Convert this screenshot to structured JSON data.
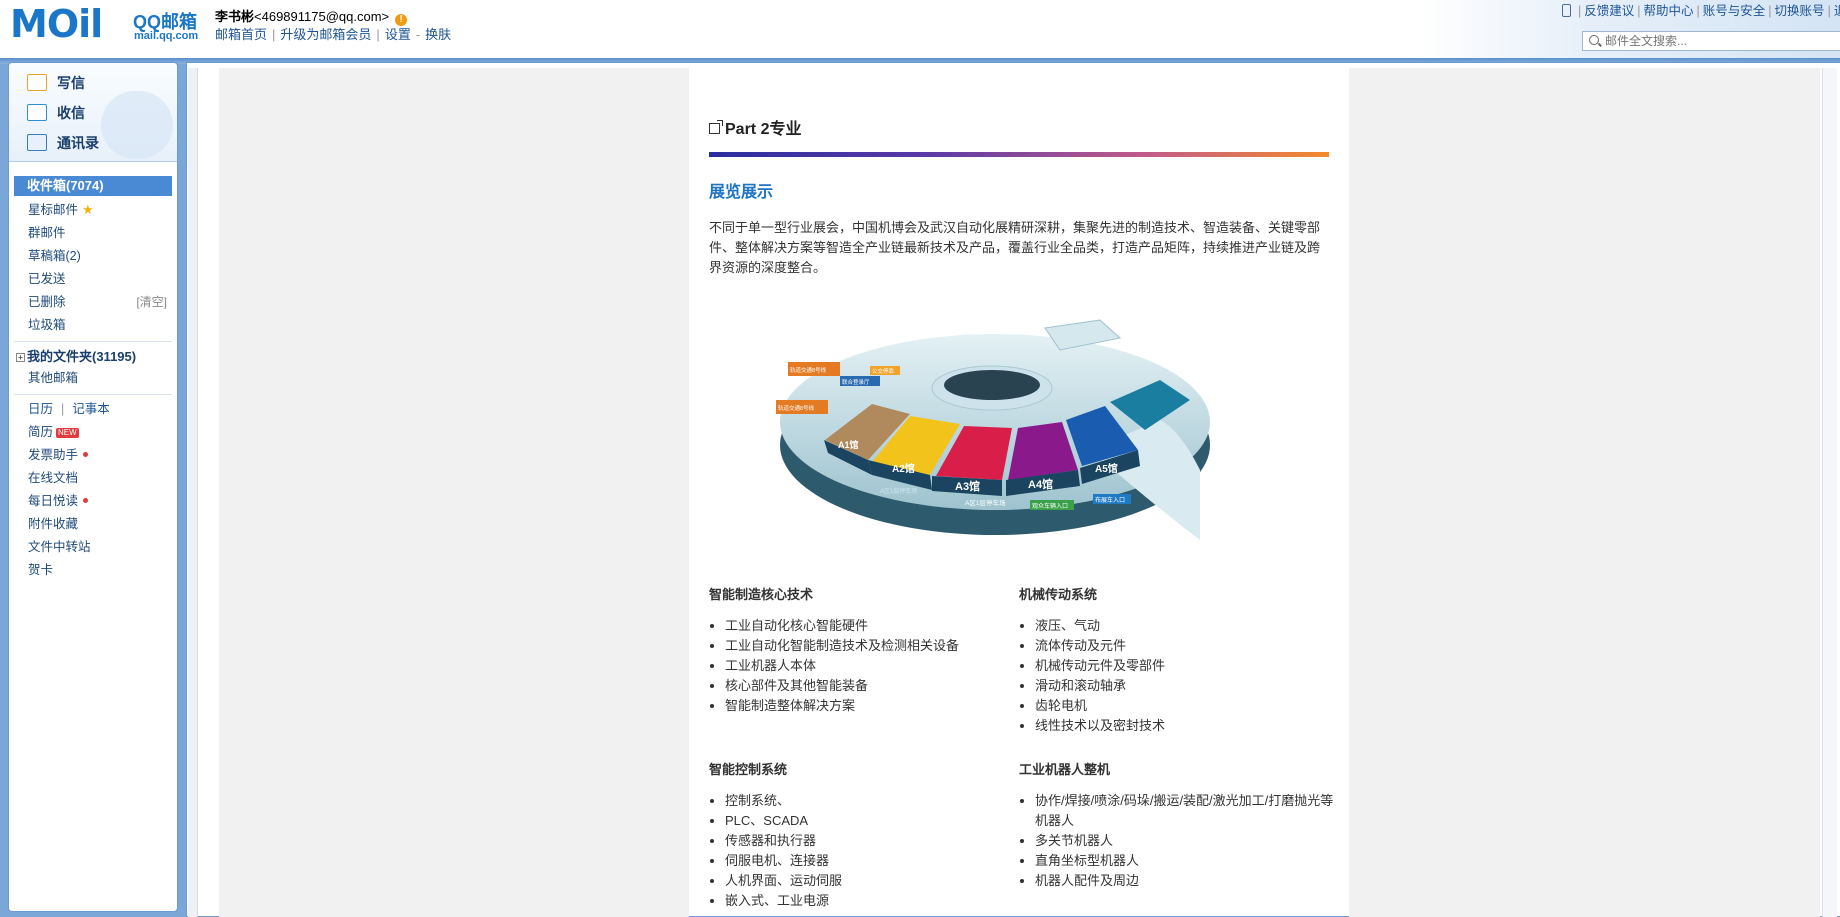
{
  "header": {
    "logo_main": "MOil",
    "logo_qq": "QQ邮箱",
    "logo_domain": "mail.qq.com",
    "user_name": "李书彬",
    "user_email": "<469891175@qq.com>",
    "warn_glyph": "!",
    "nav": [
      "邮箱首页",
      "升级为邮箱会员",
      "设置",
      "换肤"
    ],
    "top_links": [
      "反馈建议",
      "帮助中心",
      "账号与安全",
      "切换账号",
      "退"
    ],
    "search_placeholder": "邮件全文搜索..."
  },
  "sidebar": {
    "actions": [
      "写信",
      "收信",
      "通讯录"
    ],
    "inbox": "收件箱(7074)",
    "folders_primary": [
      "星标邮件",
      "群邮件",
      "草稿箱(2)",
      "已发送",
      "已删除",
      "垃圾箱"
    ],
    "clear_label": "[清空]",
    "my_folders": "我的文件夹(31195)",
    "other_mail": "其他邮箱",
    "calendar": "日历",
    "notes": "记事本",
    "tools": [
      "简历",
      "发票助手",
      "在线文档",
      "每日悦读",
      "附件收藏",
      "文件中转站",
      "贺卡"
    ],
    "new_badge": "NEW"
  },
  "mail": {
    "part_title": "Part 2专业",
    "section_heading": "展览展示",
    "intro": "不同于单一型行业展会，中国机博会及武汉自动化展精研深耕，集聚先进的制造技术、智造装备、关键零部件、整体解决方案等智造全产业链最新技术及产品，覆盖行业全品类，打造产品矩阵，持续推进产业链及跨界资源的深度整合。",
    "map_labels": {
      "a1": "A1馆",
      "a2": "A2馆",
      "a3": "A3馆",
      "a4": "A4馆",
      "a5": "A5馆",
      "parking1": "A区1层停车场",
      "parking2": "A区1层停车场",
      "entrance_bus": "布展车入口",
      "vehicle_entrance": "观众车辆入口",
      "tag1": "轨道交通8号线",
      "tag2": "轨道交通8号线",
      "tag3": "公交停靠",
      "tag4": "联合登录厅"
    },
    "lists": [
      {
        "title": "智能制造核心技术",
        "items": [
          "工业自动化核心智能硬件",
          "工业自动化智能制造技术及检测相关设备",
          "工业机器人本体",
          "核心部件及其他智能装备",
          "智能制造整体解决方案"
        ]
      },
      {
        "title": "机械传动系统",
        "items": [
          "液压、气动",
          "流体传动及元件",
          "机械传动元件及零部件",
          "滑动和滚动轴承",
          "齿轮电机",
          "线性技术以及密封技术"
        ]
      },
      {
        "title": "智能控制系统",
        "items": [
          "控制系统、",
          "PLC、SCADA",
          "传感器和执行器",
          "伺服电机、连接器",
          "人机界面、运动伺服",
          "嵌入式、工业电源"
        ]
      },
      {
        "title": "工业机器人整机",
        "items": [
          "协作/焊接/喷涂/码垛/搬运/装配/激光加工/打磨抛光等机器人",
          "多关节机器人",
          "直角坐标型机器人",
          "机器人配件及周边"
        ]
      }
    ]
  },
  "colors": {
    "brand": "#1a76c8",
    "frame": "#7aa7d8",
    "inbox_highlight": "#4a8ad4",
    "section_heading": "#1d74c5",
    "hall_a1": "#b08a5c",
    "hall_a2": "#f2c31a",
    "hall_a3": "#d91e4a",
    "hall_a4": "#8a1a8c",
    "hall_a5": "#1a5cb0"
  }
}
